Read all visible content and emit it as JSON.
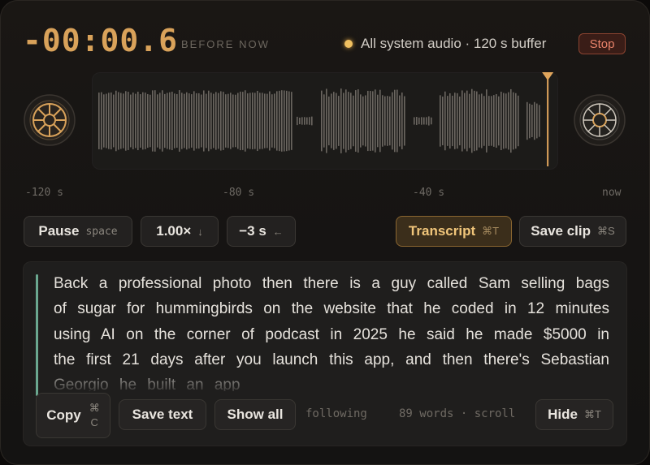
{
  "header": {
    "timer": "-00:00.6",
    "timer_caption": "BEFORE NOW",
    "source_text": "All system audio · 120 s buffer",
    "stop_label": "Stop",
    "colors": {
      "accent": "#d9a25a",
      "stop": "#e8826a",
      "transcript_quote": "#6aa78f"
    }
  },
  "timeline": {
    "ticks": [
      "-120 s",
      "-80 s",
      "-40 s",
      "now"
    ],
    "playhead_fraction": 0.995
  },
  "controls": {
    "pause": {
      "label": "Pause",
      "hint": "space"
    },
    "speed": {
      "label": "1.00×",
      "hint": "↓"
    },
    "skip": {
      "label": "−3 s",
      "hint": "←"
    },
    "transcript": {
      "label": "Transcript",
      "hint": "⌘T"
    },
    "save_clip": {
      "label": "Save clip",
      "hint": "⌘S"
    }
  },
  "transcript": {
    "text": "Back a professional photo then there is a guy called Sam selling bags of sugar for hummingbirds on the website that he coded in 12 minutes using AI on the corner of podcast in 2025 he said he made $5000 in the first 21 days after you launch this app, and then there's Sebastian Georgio he built an app",
    "copy": {
      "label": "Copy",
      "key1": "⌘",
      "key2": "C"
    },
    "save_text_label": "Save text",
    "show_all_label": "Show all",
    "following_label": "following",
    "words_status": "89 words · scroll",
    "hide": {
      "label": "Hide",
      "hint": "⌘T"
    }
  },
  "icons": {
    "left_reel": "reel-icon",
    "right_reel": "reel-icon",
    "playhead": "playhead-marker-icon"
  }
}
